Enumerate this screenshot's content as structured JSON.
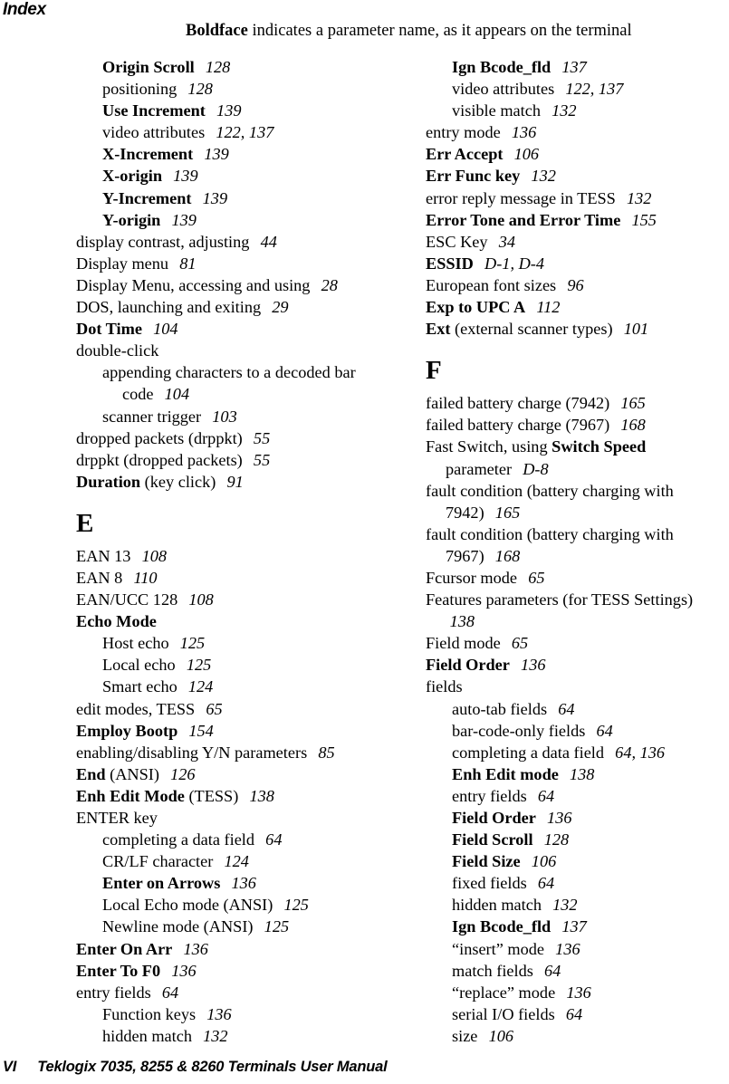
{
  "header": {
    "running_head": "Index",
    "note_bold": "Boldface",
    "note_rest": " indicates a parameter name, as it appears on the terminal"
  },
  "footer": {
    "folio": "VI",
    "manual_title": "Teklogix 7035, 8255 & 8260 Terminals User Manual"
  },
  "columns": [
    {
      "name": "left-column",
      "blocks": [
        {
          "type": "entries",
          "entries": [
            {
              "level": 1,
              "bold": "Origin Scroll",
              "text": "",
              "pages": "128"
            },
            {
              "level": 1,
              "bold": "",
              "text": "positioning",
              "pages": "128"
            },
            {
              "level": 1,
              "bold": "Use Increment",
              "text": "",
              "pages": "139"
            },
            {
              "level": 1,
              "bold": "",
              "text": "video attributes",
              "pages": "122, 137"
            },
            {
              "level": 1,
              "bold": "X-Increment",
              "text": "",
              "pages": "139"
            },
            {
              "level": 1,
              "bold": "X-origin",
              "text": "",
              "pages": "139"
            },
            {
              "level": 1,
              "bold": "Y-Increment",
              "text": "",
              "pages": "139"
            },
            {
              "level": 1,
              "bold": "Y-origin",
              "text": "",
              "pages": "139"
            },
            {
              "level": 0,
              "bold": "",
              "text": "display contrast, adjusting",
              "pages": "44"
            },
            {
              "level": 0,
              "bold": "",
              "text": "Display menu",
              "pages": "81"
            },
            {
              "level": 0,
              "bold": "",
              "text": "Display Menu, accessing and using",
              "pages": "28"
            },
            {
              "level": 0,
              "bold": "",
              "text": "DOS, launching and exiting",
              "pages": "29"
            },
            {
              "level": 0,
              "bold": "Dot Time",
              "text": "",
              "pages": "104"
            },
            {
              "level": 0,
              "bold": "",
              "text": "double-click",
              "pages": ""
            },
            {
              "level": 1,
              "bold": "",
              "text": "appending characters to a decoded bar code",
              "pages": "104"
            },
            {
              "level": 1,
              "bold": "",
              "text": "scanner trigger",
              "pages": "103"
            },
            {
              "level": 0,
              "bold": "",
              "text": "dropped packets (drppkt)",
              "pages": "55"
            },
            {
              "level": 0,
              "bold": "",
              "text": "drppkt (dropped packets)",
              "pages": "55"
            },
            {
              "level": 0,
              "bold": "Duration",
              "text": " (key click)",
              "pages": "91"
            }
          ]
        },
        {
          "type": "section",
          "letter": "E",
          "entries": [
            {
              "level": 0,
              "bold": "",
              "text": "EAN 13",
              "pages": "108"
            },
            {
              "level": 0,
              "bold": "",
              "text": "EAN 8",
              "pages": "110"
            },
            {
              "level": 0,
              "bold": "",
              "text": "EAN/UCC 128",
              "pages": "108"
            },
            {
              "level": 0,
              "bold": "Echo Mode",
              "text": "",
              "pages": ""
            },
            {
              "level": 1,
              "bold": "",
              "text": "Host echo",
              "pages": "125"
            },
            {
              "level": 1,
              "bold": "",
              "text": "Local echo",
              "pages": "125"
            },
            {
              "level": 1,
              "bold": "",
              "text": "Smart echo",
              "pages": "124"
            },
            {
              "level": 0,
              "bold": "",
              "text": "edit modes, TESS",
              "pages": "65"
            },
            {
              "level": 0,
              "bold": "Employ Bootp",
              "text": "",
              "pages": "154"
            },
            {
              "level": 0,
              "bold": "",
              "text": "enabling/disabling Y/N parameters",
              "pages": "85"
            },
            {
              "level": 0,
              "bold": "End",
              "text": " (ANSI)",
              "pages": "126"
            },
            {
              "level": 0,
              "bold": "Enh Edit Mode",
              "text": " (TESS)",
              "pages": "138"
            },
            {
              "level": 0,
              "bold": "",
              "text": "ENTER key",
              "pages": ""
            },
            {
              "level": 1,
              "bold": "",
              "text": "completing a data field",
              "pages": "64"
            },
            {
              "level": 1,
              "bold": "",
              "text": "CR/LF character",
              "pages": "124"
            },
            {
              "level": 1,
              "bold": "Enter on Arrows",
              "text": "",
              "pages": "136"
            },
            {
              "level": 1,
              "bold": "",
              "text": "Local Echo mode (ANSI)",
              "pages": "125"
            },
            {
              "level": 1,
              "bold": "",
              "text": "Newline mode (ANSI)",
              "pages": "125"
            },
            {
              "level": 0,
              "bold": "Enter On Arr",
              "text": "",
              "pages": "136"
            },
            {
              "level": 0,
              "bold": "Enter To F0",
              "text": "",
              "pages": "136"
            },
            {
              "level": 0,
              "bold": "",
              "text": "entry fields",
              "pages": "64"
            },
            {
              "level": 1,
              "bold": "",
              "text": "Function keys",
              "pages": "136"
            },
            {
              "level": 1,
              "bold": "",
              "text": "hidden match",
              "pages": "132"
            }
          ]
        }
      ]
    },
    {
      "name": "right-column",
      "blocks": [
        {
          "type": "entries",
          "entries": [
            {
              "level": 1,
              "bold": "Ign Bcode_fld",
              "text": "",
              "pages": "137"
            },
            {
              "level": 1,
              "bold": "",
              "text": "video attributes",
              "pages": "122, 137"
            },
            {
              "level": 1,
              "bold": "",
              "text": "visible match",
              "pages": "132"
            },
            {
              "level": 0,
              "bold": "",
              "text": "entry mode",
              "pages": "136"
            },
            {
              "level": 0,
              "bold": "Err Accept",
              "text": "",
              "pages": "106"
            },
            {
              "level": 0,
              "bold": "Err Func key",
              "text": "",
              "pages": "132"
            },
            {
              "level": 0,
              "bold": "",
              "text": "error reply message in TESS",
              "pages": "132"
            },
            {
              "level": 0,
              "bold": "Error Tone and Error Time",
              "text": "",
              "pages": "155"
            },
            {
              "level": 0,
              "bold": "",
              "text": "ESC Key",
              "pages": "34"
            },
            {
              "level": 0,
              "bold": "ESSID",
              "text": "",
              "pages": "D-1, D-4"
            },
            {
              "level": 0,
              "bold": "",
              "text": "European font sizes",
              "pages": "96"
            },
            {
              "level": 0,
              "bold": "Exp to UPC A",
              "text": "",
              "pages": "112"
            },
            {
              "level": 0,
              "bold": "Ext",
              "text": " (external scanner types)",
              "pages": "101"
            }
          ]
        },
        {
          "type": "section",
          "letter": "F",
          "entries": [
            {
              "level": 0,
              "bold": "",
              "text": "failed battery charge (7942)",
              "pages": "165"
            },
            {
              "level": 0,
              "bold": "",
              "text": "failed battery charge (7967)",
              "pages": "168"
            },
            {
              "level": 0,
              "bold": "",
              "text": "Fast Switch, using ",
              "bold_tail": "Switch Speed",
              "text_tail": " parameter",
              "pages": "D-8"
            },
            {
              "level": 0,
              "bold": "",
              "text": "fault condition (battery charging with 7942)",
              "pages": "165"
            },
            {
              "level": 0,
              "bold": "",
              "text": "fault condition (battery charging with 7967)",
              "pages": "168"
            },
            {
              "level": 0,
              "bold": "",
              "text": "Fcursor mode",
              "pages": "65"
            },
            {
              "level": 0,
              "bold": "",
              "text": "Features parameters (for TESS Settings)",
              "pages": "138"
            },
            {
              "level": 0,
              "bold": "",
              "text": "Field mode",
              "pages": "65"
            },
            {
              "level": 0,
              "bold": "Field Order",
              "text": "",
              "pages": "136"
            },
            {
              "level": 0,
              "bold": "",
              "text": "fields",
              "pages": ""
            },
            {
              "level": 1,
              "bold": "",
              "text": "auto-tab fields",
              "pages": "64"
            },
            {
              "level": 1,
              "bold": "",
              "text": "bar-code-only fields",
              "pages": "64"
            },
            {
              "level": 1,
              "bold": "",
              "text": "completing a data field",
              "pages": "64, 136"
            },
            {
              "level": 1,
              "bold": "Enh Edit mode",
              "text": "",
              "pages": "138"
            },
            {
              "level": 1,
              "bold": "",
              "text": "entry fields",
              "pages": "64"
            },
            {
              "level": 1,
              "bold": "Field Order",
              "text": "",
              "pages": "136"
            },
            {
              "level": 1,
              "bold": "Field Scroll",
              "text": "",
              "pages": "128"
            },
            {
              "level": 1,
              "bold": "Field Size",
              "text": "",
              "pages": "106"
            },
            {
              "level": 1,
              "bold": "",
              "text": "fixed fields",
              "pages": "64"
            },
            {
              "level": 1,
              "bold": "",
              "text": "hidden match",
              "pages": "132"
            },
            {
              "level": 1,
              "bold": "Ign Bcode_fld",
              "text": "",
              "pages": "137"
            },
            {
              "level": 1,
              "bold": "",
              "text": "“insert” mode",
              "pages": "136"
            },
            {
              "level": 1,
              "bold": "",
              "text": "match fields",
              "pages": "64"
            },
            {
              "level": 1,
              "bold": "",
              "text": "“replace” mode",
              "pages": "136"
            },
            {
              "level": 1,
              "bold": "",
              "text": "serial I/O fields",
              "pages": "64"
            },
            {
              "level": 1,
              "bold": "",
              "text": "size",
              "pages": "106"
            }
          ]
        }
      ]
    }
  ]
}
